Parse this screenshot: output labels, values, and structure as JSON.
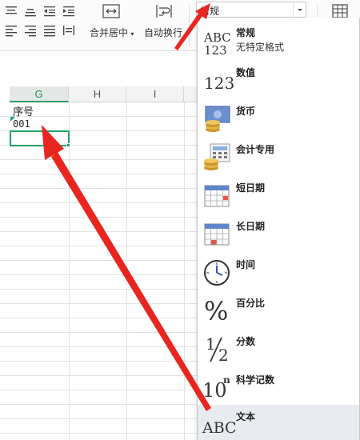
{
  "ribbon": {
    "merge_center_label": "合并居中",
    "wrap_text_label": "自动换行",
    "number_format_value": "常规"
  },
  "sheet": {
    "columns": [
      "G",
      "H",
      "I"
    ],
    "active_column": "G",
    "cells": {
      "g_header": "序号",
      "g_value": "001"
    }
  },
  "format_menu": {
    "items": [
      {
        "label": "常规",
        "sublabel": "无特定格式",
        "icon": "abc-123-icon",
        "icon_text_top": "ABC",
        "icon_text_bottom": "123"
      },
      {
        "label": "数值",
        "icon": "number-123-icon",
        "icon_text": "123"
      },
      {
        "label": "货币",
        "icon": "currency-coins-icon"
      },
      {
        "label": "会计专用",
        "icon": "accounting-icon"
      },
      {
        "label": "短日期",
        "icon": "calendar-short-icon"
      },
      {
        "label": "长日期",
        "icon": "calendar-long-icon"
      },
      {
        "label": "时间",
        "icon": "clock-icon"
      },
      {
        "label": "百分比",
        "icon": "percent-icon",
        "icon_text": "%"
      },
      {
        "label": "分数",
        "icon": "fraction-icon",
        "icon_text_num": "1",
        "icon_text_den": "2"
      },
      {
        "label": "科学记数",
        "icon": "scientific-icon",
        "icon_text": "10",
        "icon_text_exp": "n"
      },
      {
        "label": "文本",
        "icon": "text-abc-icon",
        "icon_text": "ABC"
      }
    ],
    "hovered": "文本"
  },
  "colors": {
    "accent_green": "#21a366",
    "annotation_red": "#e8261f",
    "menu_hover": "#e8ebef"
  }
}
